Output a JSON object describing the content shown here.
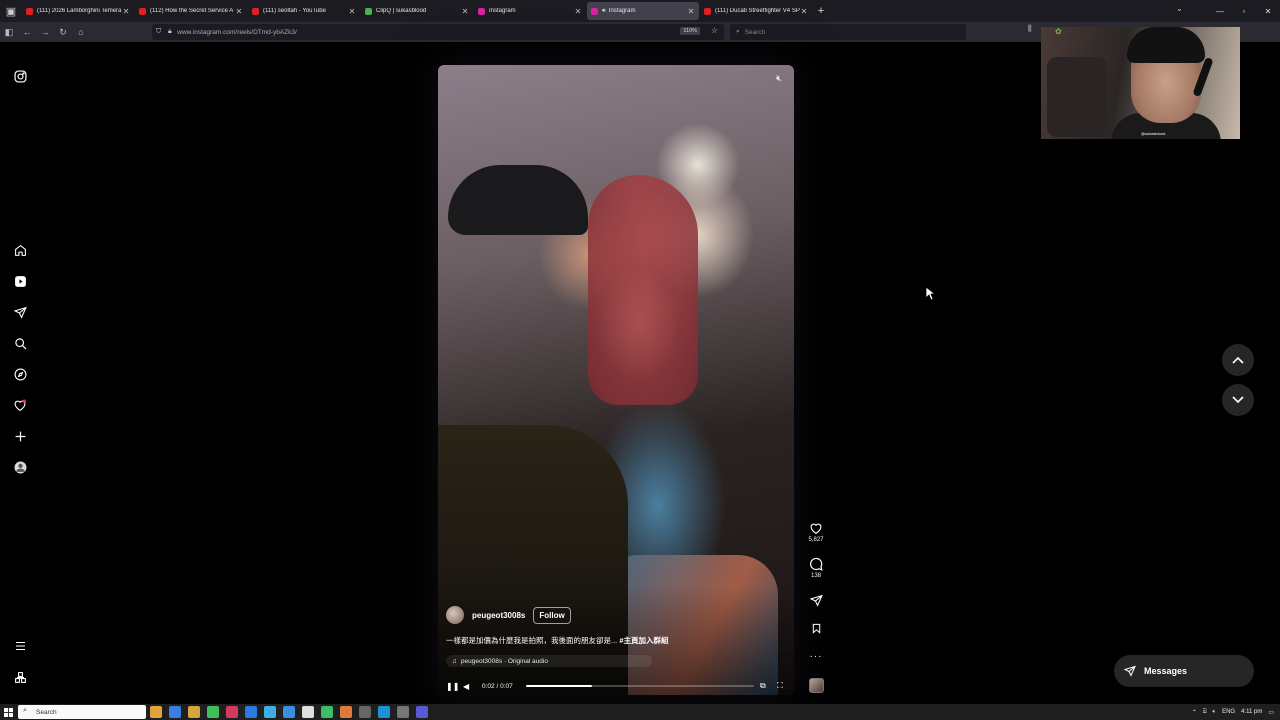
{
  "browser": {
    "tabs": [
      {
        "title": "(111) 2026 Lamborghini Temera",
        "favicon_color": "#e02020",
        "active": false
      },
      {
        "title": "(112) How the Secret Service A",
        "favicon_color": "#e02020",
        "active": false
      },
      {
        "title": "(111) seoltah - YouTube",
        "favicon_color": "#e02020",
        "active": false
      },
      {
        "title": "ClipQ | sukasblood",
        "favicon_color": "#4caf50",
        "active": false
      },
      {
        "title": "Instagram",
        "favicon_color": "#d6249f",
        "active": false
      },
      {
        "title": "Instagram",
        "favicon_color": "#d6249f",
        "active": true
      },
      {
        "title": "(111) Ducati Streetfighter V4 SP",
        "favicon_color": "#e02020",
        "active": false
      }
    ],
    "url": "www.instagram.com/reels/DTmd-ybAZk3/",
    "zoom": "110%",
    "search_placeholder": "Search"
  },
  "reel": {
    "username": "peugeot3008s",
    "follow_label": "Follow",
    "caption_text": "一樣都是加價為什麼我是拍照，我後面的朋友卻是...",
    "caption_hashtag": "#主頁加入群組",
    "audio": "peugeot3008s · Original audio",
    "time": "0:02 / 0:07",
    "progress": 0.29,
    "likes": "5,827",
    "comments": "138"
  },
  "messages_label": "Messages",
  "webcam": {
    "tag": "@sukasblood"
  },
  "taskbar": {
    "search_placeholder": "Search",
    "lang": "ENG",
    "time": "4:11 pm"
  },
  "colors": {
    "page_bg": "#000000",
    "button_bg": "#262626",
    "tab_active": "#42414d",
    "chrome_bg": "#1c1b22"
  }
}
